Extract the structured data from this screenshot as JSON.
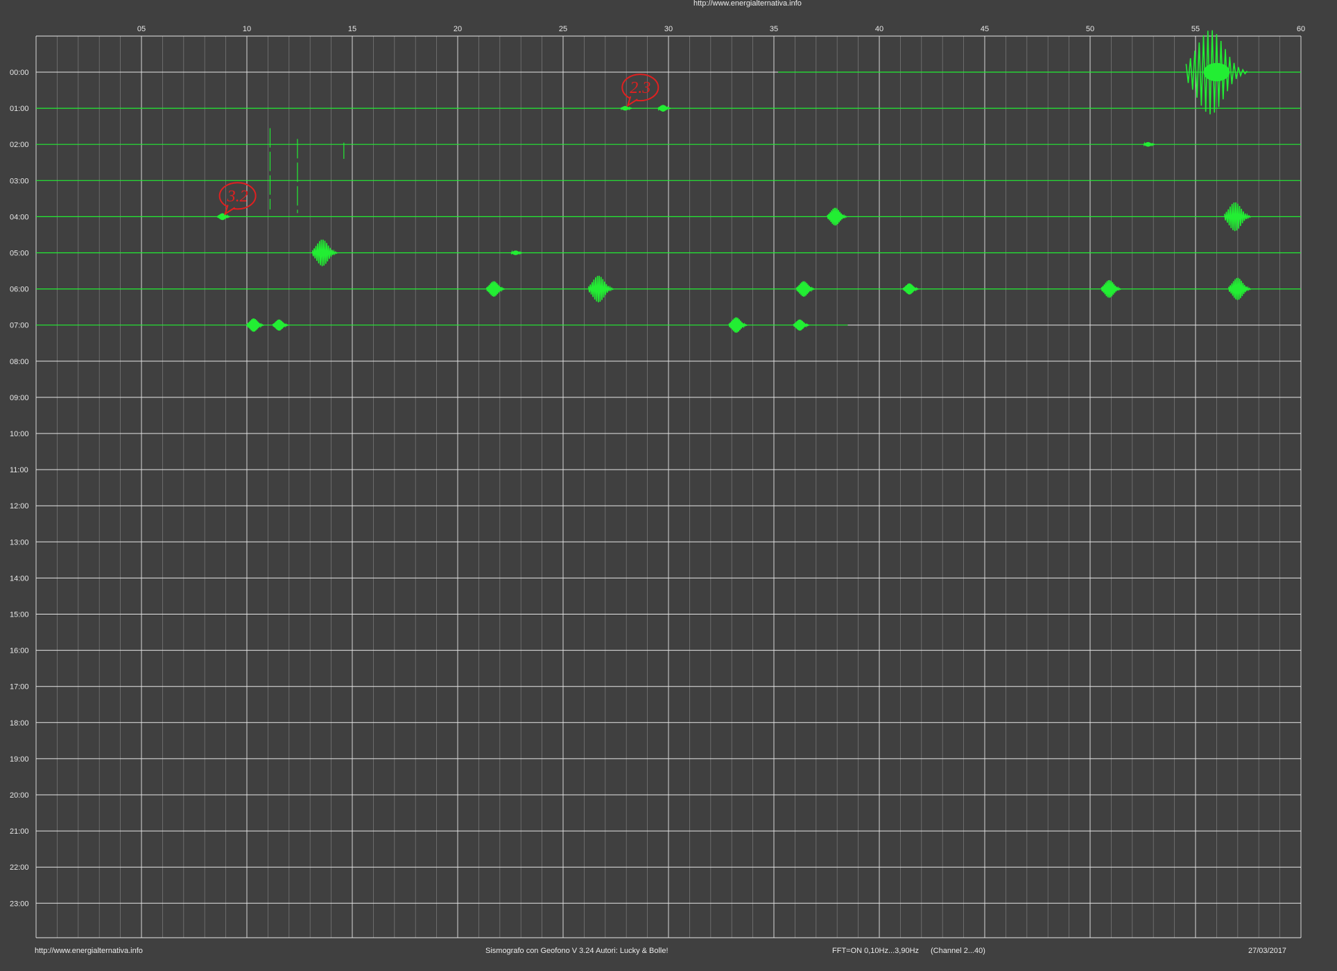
{
  "header": {
    "url": "http://www.energialternativa.info"
  },
  "footer": {
    "url": "http://www.energialternativa.info",
    "software": "Sismografo con Geofono V 3.24  Autori: Lucky & Bolle!",
    "fft": "FFT=ON 0,10Hz...3,90Hz",
    "channel": "(Channel 2...40)",
    "date": "27/03/2017"
  },
  "colors": {
    "background": "#404040",
    "grid_major": "#e8e8e8",
    "grid_minor": "#8a8a8a",
    "trace": "#22ee33",
    "annotation": "#e02020"
  },
  "chart_data": {
    "type": "line",
    "title": "",
    "x_ticks": [
      "05",
      "10",
      "15",
      "20",
      "25",
      "30",
      "35",
      "40",
      "45",
      "50",
      "55",
      "60"
    ],
    "xlim": [
      0,
      60
    ],
    "y_hours": [
      "00:00",
      "01:00",
      "02:00",
      "03:00",
      "04:00",
      "05:00",
      "06:00",
      "07:00",
      "08:00",
      "09:00",
      "10:00",
      "11:00",
      "12:00",
      "13:00",
      "14:00",
      "15:00",
      "16:00",
      "17:00",
      "18:00",
      "19:00",
      "20:00",
      "21:00",
      "22:00",
      "23:00"
    ],
    "grid": true,
    "recorded_until": {
      "hour": "07:00",
      "minute": 38.5
    },
    "traces": [
      {
        "hour": "00:00",
        "start_minute": 35.2,
        "events": [
          {
            "minute": 56.0,
            "amp": 3.8
          }
        ]
      },
      {
        "hour": "01:00",
        "start_minute": 0,
        "events": [
          {
            "minute": 28.0,
            "amp": 0.2
          },
          {
            "minute": 29.8,
            "amp": 0.3
          }
        ]
      },
      {
        "hour": "02:00",
        "start_minute": 0,
        "events": [
          {
            "minute": 52.8,
            "amp": 0.2
          }
        ]
      },
      {
        "hour": "03:00",
        "start_minute": 0,
        "events": []
      },
      {
        "hour": "04:00",
        "start_minute": 0,
        "events": [
          {
            "minute": 8.9,
            "amp": 0.3
          },
          {
            "minute": 38.0,
            "amp": 0.8
          },
          {
            "minute": 57.0,
            "amp": 1.3
          }
        ]
      },
      {
        "hour": "05:00",
        "start_minute": 0,
        "events": [
          {
            "minute": 13.7,
            "amp": 1.2
          },
          {
            "minute": 22.8,
            "amp": 0.2
          }
        ]
      },
      {
        "hour": "06:00",
        "start_minute": 0,
        "events": [
          {
            "minute": 21.8,
            "amp": 0.7
          },
          {
            "minute": 26.8,
            "amp": 1.2
          },
          {
            "minute": 36.5,
            "amp": 0.7
          },
          {
            "minute": 41.5,
            "amp": 0.5
          },
          {
            "minute": 51.0,
            "amp": 0.8
          },
          {
            "minute": 57.1,
            "amp": 1.0
          }
        ]
      },
      {
        "hour": "07:00",
        "start_minute": 0,
        "events": [
          {
            "minute": 10.4,
            "amp": 0.6
          },
          {
            "minute": 11.6,
            "amp": 0.5
          },
          {
            "minute": 33.3,
            "amp": 0.7
          },
          {
            "minute": 36.3,
            "amp": 0.5
          }
        ]
      }
    ],
    "annotations": [
      {
        "text": "2.3",
        "hour": "01:00",
        "minute": 28.2
      },
      {
        "text": "3.2",
        "hour": "04:00",
        "minute": 9.1
      }
    ]
  }
}
